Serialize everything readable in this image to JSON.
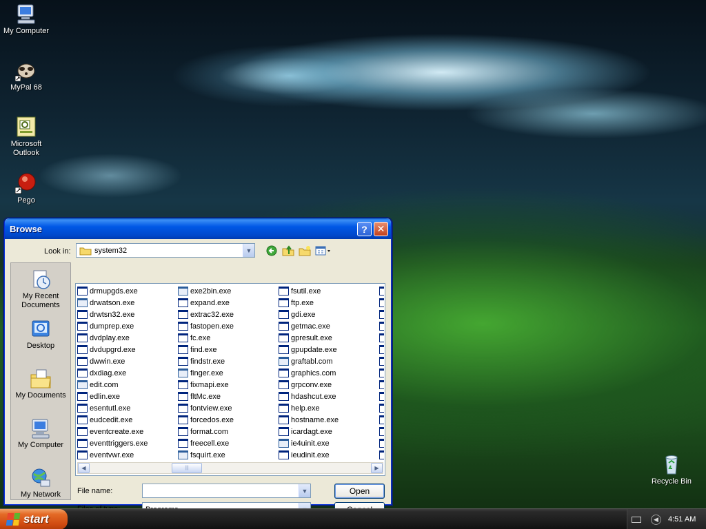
{
  "desktop": {
    "icons": [
      {
        "label": "My Computer"
      },
      {
        "label": "MyPal 68"
      },
      {
        "label": "Microsoft Outlook"
      },
      {
        "label": "Pego"
      },
      {
        "label": "Recycle Bin"
      }
    ]
  },
  "dialog": {
    "title": "Browse",
    "help_glyph": "?",
    "close_glyph": "✕",
    "look_in_label": "Look in:",
    "look_in_value": "system32",
    "places": [
      {
        "label": "My Recent Documents"
      },
      {
        "label": "Desktop"
      },
      {
        "label": "My Documents"
      },
      {
        "label": "My Computer"
      },
      {
        "label": "My Network"
      }
    ],
    "files": [
      "drmupgds.exe",
      "drwatson.exe",
      "drwtsn32.exe",
      "dumprep.exe",
      "dvdplay.exe",
      "dvdupgrd.exe",
      "dwwin.exe",
      "dxdiag.exe",
      "edit.com",
      "edlin.exe",
      "esentutl.exe",
      "eudcedit.exe",
      "eventcreate.exe",
      "eventtriggers.exe",
      "eventvwr.exe",
      "exe2bin.exe",
      "expand.exe",
      "extrac32.exe",
      "fastopen.exe",
      "fc.exe",
      "find.exe",
      "findstr.exe",
      "finger.exe",
      "fixmapi.exe",
      "fltMc.exe",
      "fontview.exe",
      "forcedos.exe",
      "format.com",
      "freecell.exe",
      "fsquirt.exe",
      "fsutil.exe",
      "ftp.exe",
      "gdi.exe",
      "getmac.exe",
      "gpresult.exe",
      "gpupdate.exe",
      "graftabl.com",
      "graphics.com",
      "grpconv.exe",
      "hdashcut.exe",
      "help.exe",
      "hostname.exe",
      "icardagt.exe",
      "ie4uinit.exe",
      "ieudinit.exe"
    ],
    "file_name_label": "File name:",
    "file_name_value": "",
    "files_of_type_label": "Files of type:",
    "files_of_type_value": "Programs",
    "open_label": "Open",
    "cancel_label": "Cancel"
  },
  "taskbar": {
    "start_label": "start",
    "clock": "4:51 AM"
  }
}
